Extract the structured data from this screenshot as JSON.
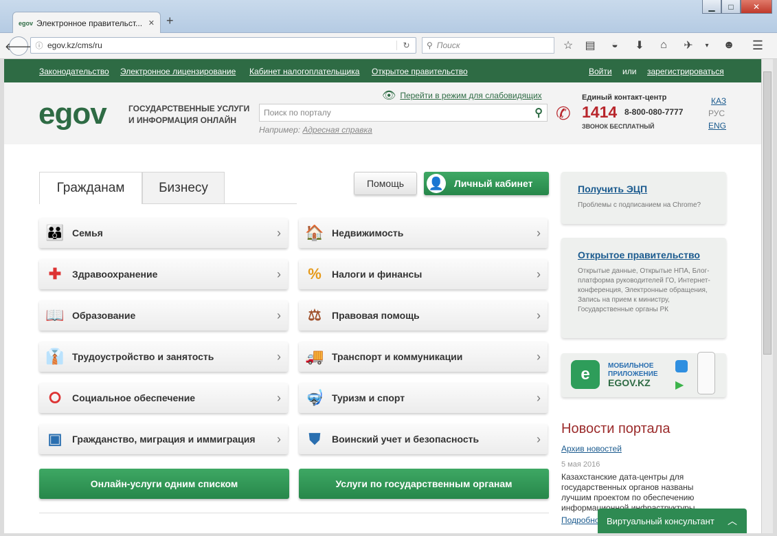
{
  "browser": {
    "tab_title": "Электронное правительст...",
    "favicon_text": "egov",
    "url": "egov.kz/cms/ru",
    "search_placeholder": "Поиск",
    "win_min": "▁",
    "win_max": "□",
    "win_close": "✕",
    "tab_close": "✕",
    "new_tab": "+"
  },
  "topnav": {
    "links": [
      "Законодательство",
      "Электронное лицензирование",
      "Кабинет налогоплательщика",
      "Открытое правительство"
    ],
    "login": "Войти",
    "or": "или",
    "register": "зарегистрироваться"
  },
  "header": {
    "logo": "egov",
    "tagline_1": "ГОСУДАРСТВЕННЫЕ УСЛУГИ",
    "tagline_2": "И ИНФОРМАЦИЯ ОНЛАЙН",
    "accessibility": "Перейти в режим для слабовидящих",
    "search_placeholder": "Поиск по порталу",
    "example_label": "Например:",
    "example_link": "Адресная справка",
    "contact_title": "Единый контакт-центр",
    "phone_short": "1414",
    "phone_long": "8-800-080-7777",
    "free_call": "ЗВОНОК БЕСПЛАТНЫЙ",
    "langs": [
      "КАЗ",
      "РУС",
      "ENG"
    ]
  },
  "tabs": [
    "Гражданам",
    "Бизнесу"
  ],
  "buttons": {
    "help": "Помощь",
    "cabinet": "Личный кабинет",
    "online_list": "Онлайн-услуги одним списком",
    "by_agency": "Услуги по государственным органам"
  },
  "services_left": [
    "Семья",
    "Здравоохранение",
    "Образование",
    "Трудоустройство и занятость",
    "Социальное обеспечение",
    "Гражданство, миграция и иммиграция"
  ],
  "services_right": [
    "Недвижимость",
    "Налоги и финансы",
    "Правовая помощь",
    "Транспорт и коммуникации",
    "Туризм и спорт",
    "Воинский учет и безопасность"
  ],
  "sidebar": {
    "eds_title": "Получить ЭЦП",
    "eds_text": "Проблемы с подписанием на Chrome?",
    "og_title": "Открытое правительство",
    "og_text": "Открытые данные, Открытые НПА, Блог-платформа руководителей ГО, Интернет-конференция, Электронные обращения, Запись на прием к министру, Государственные органы РК",
    "app_line1": "МОБИЛЬНОЕ",
    "app_line2": "ПРИЛОЖЕНИЕ",
    "app_name": "EGOV.KZ",
    "news_title": "Новости портала",
    "news_archive": "Архив новостей",
    "news_date": "5 мая 2016",
    "news_text": "Казахстанские дата-центры для государственных органов названы лучшим проектом по обеспечению информационной инфраструктуры",
    "news_more": "Подробно"
  },
  "consultant": "Виртуальный консультант",
  "colors": {
    "brand_green": "#2e6b44",
    "button_green": "#2f9a57",
    "news_title": "#9b2b2b",
    "phone_red": "#b8262c"
  }
}
